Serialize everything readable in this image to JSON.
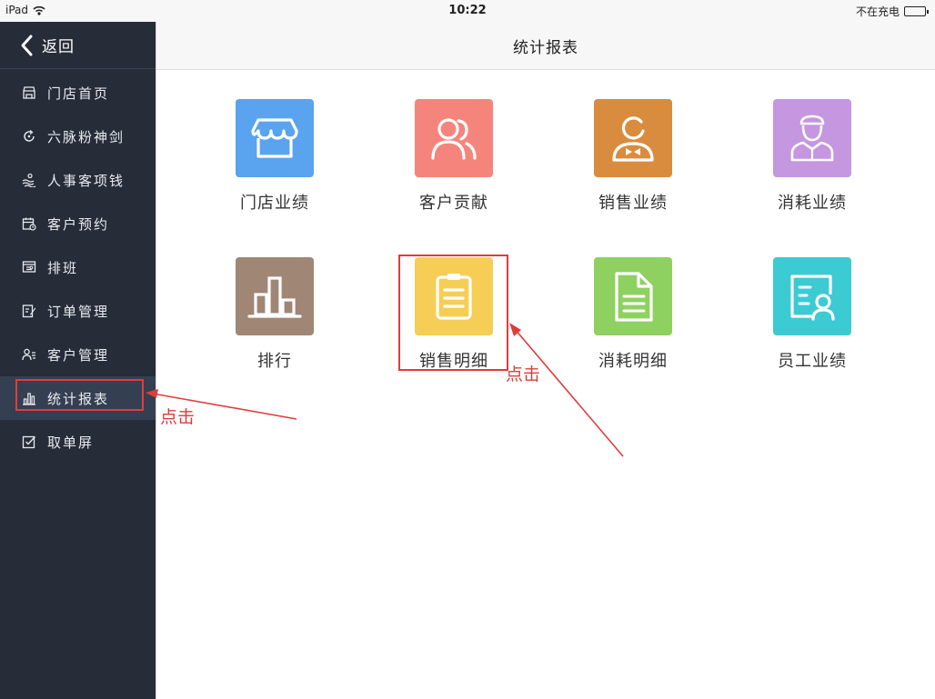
{
  "status_bar": {
    "device": "iPad",
    "time": "10:22",
    "charge": "不在充电"
  },
  "sidebar": {
    "back_label": "返回",
    "items": [
      {
        "label": "门店首页",
        "icon": "store-icon"
      },
      {
        "label": "六脉粉神剑",
        "icon": "refresh-icon"
      },
      {
        "label": "人事客项钱",
        "icon": "people-money-icon"
      },
      {
        "label": "客户预约",
        "icon": "calendar-icon"
      },
      {
        "label": "排班",
        "icon": "schedule-icon"
      },
      {
        "label": "订单管理",
        "icon": "edit-order-icon"
      },
      {
        "label": "客户管理",
        "icon": "customer-list-icon"
      },
      {
        "label": "统计报表",
        "icon": "bar-chart-icon",
        "active": true
      },
      {
        "label": "取单屏",
        "icon": "checkbox-icon"
      }
    ]
  },
  "header": {
    "title": "统计报表"
  },
  "tiles": [
    {
      "label": "门店业绩",
      "icon": "storefront-icon",
      "color": "#5aa3ef"
    },
    {
      "label": "客户贡献",
      "icon": "customers-icon",
      "color": "#f5857c"
    },
    {
      "label": "销售业绩",
      "icon": "salesperson-icon",
      "color": "#d98c3d"
    },
    {
      "label": "消耗业绩",
      "icon": "worker-icon",
      "color": "#c597e0"
    },
    {
      "label": "排行",
      "icon": "ranking-icon",
      "color": "#a08675"
    },
    {
      "label": "销售明细",
      "icon": "clipboard-icon",
      "color": "#f6cd55"
    },
    {
      "label": "消耗明细",
      "icon": "document-icon",
      "color": "#8fd161"
    },
    {
      "label": "员工业绩",
      "icon": "employee-card-icon",
      "color": "#3ccad3"
    }
  ],
  "annotations": {
    "click_sidebar": "点击",
    "click_tile": "点击",
    "color": "#e03c3c"
  }
}
